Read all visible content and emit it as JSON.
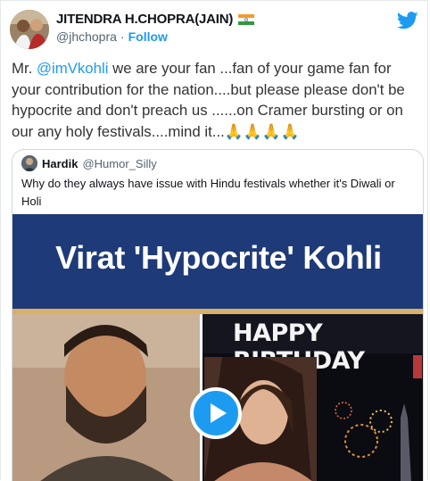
{
  "author": {
    "name": "JITENDRA H.CHOPRA(JAIN)",
    "handle": "@jhchopra",
    "separator": "·",
    "follow_label": "Follow",
    "flag_icon": "india-flag-icon",
    "verified": false
  },
  "tweet": {
    "text_prefix": "Mr. ",
    "mention": "@imVkohli",
    "text_body": " we are your fan ...fan of your game fan for your contribution for the nation....but please please don't be hypocrite and don't preach us ......on Cramer bursting or on our any holy festivals....mind it...🙏🙏🙏🙏"
  },
  "quoted": {
    "name": "Hardik",
    "handle": "@Humor_Silly",
    "text": "Why do they always have issue with Hindu festivals whether it's Diwali or Holi",
    "video": {
      "banner_title": "Virat 'Hypocrite' Kohli",
      "birthday_text": "HAPPY BIRTHDAY",
      "play_icon": "play-icon"
    }
  },
  "brand": {
    "icon": "twitter-bird-icon",
    "color": "#1d9bf0"
  },
  "colors": {
    "accent": "#1d9bf0",
    "banner": "#1e3a78",
    "text": "#0f1419",
    "muted": "#536471"
  }
}
